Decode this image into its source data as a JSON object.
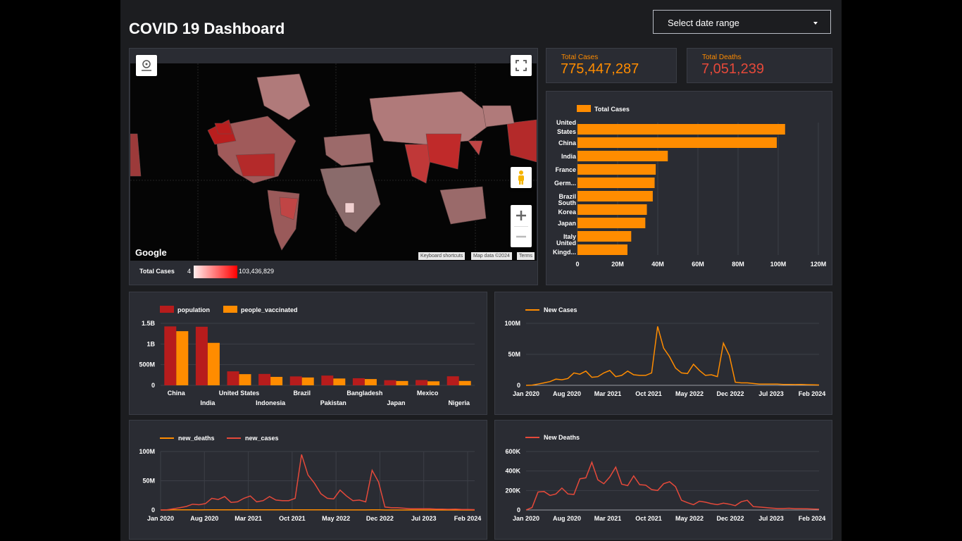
{
  "title": "COVID 19 Dashboard",
  "date_range": {
    "label": "Select date range"
  },
  "kpis": {
    "total_cases": {
      "label": "Total Cases",
      "value": "775,447,287",
      "color": "#ff8c00"
    },
    "total_deaths": {
      "label": "Total Deaths",
      "value": "7,051,239",
      "color": "#e5493a"
    }
  },
  "map": {
    "legend_label": "Total Cases",
    "legend_min": "4",
    "legend_max": "103,436,829",
    "google": "Google",
    "attribution": [
      "Keyboard shortcuts",
      "Map data ©2024",
      "Terms"
    ],
    "icons": [
      "geolocate-icon",
      "fullscreen-icon",
      "pegman-icon",
      "zoom-in-icon",
      "zoom-out-icon"
    ]
  },
  "chart_data": [
    {
      "type": "bar",
      "orientation": "horizontal",
      "legend": [
        "Total Cases"
      ],
      "categories": [
        "United States",
        "China",
        "India",
        "France",
        "Germany",
        "Brazil",
        "South Korea",
        "Japan",
        "Italy",
        "United Kingdom"
      ],
      "tick_text": [
        [
          "United",
          "States"
        ],
        [
          "China"
        ],
        [
          "India"
        ],
        [
          "France"
        ],
        [
          "Germ..."
        ],
        [
          "Brazil"
        ],
        [
          "South",
          "Korea"
        ],
        [
          "Japan"
        ],
        [
          "Italy"
        ],
        [
          "United",
          "Kingd..."
        ]
      ],
      "values": [
        103436829,
        99300000,
        45000000,
        38990000,
        38440000,
        37510000,
        34570000,
        33800000,
        26780000,
        24900000
      ],
      "xlim": [
        0,
        120000000
      ],
      "xticks": [
        "0",
        "20M",
        "40M",
        "60M",
        "80M",
        "100M",
        "120M"
      ],
      "color": "#ff8c00",
      "grid": true
    },
    {
      "type": "bar",
      "series": [
        {
          "name": "population",
          "color": "#b71c1c",
          "values": [
            1425900000,
            1417200000,
            338300000,
            275500000,
            215300000,
            235800000,
            171200000,
            123900000,
            127500000,
            218500000
          ]
        },
        {
          "name": "people_vaccinated",
          "color": "#ff8c00",
          "values": [
            1310300000,
            1027400000,
            270200000,
            204400000,
            189600000,
            165000000,
            151500000,
            104700000,
            97200000,
            105600000
          ]
        }
      ],
      "categories": [
        "China",
        "India",
        "United States",
        "Indonesia",
        "Brazil",
        "Pakistan",
        "Bangladesh",
        "Japan",
        "Mexico",
        "Nigeria"
      ],
      "ylim": [
        0,
        1500000000
      ],
      "yticks": [
        "0",
        "500M",
        "1B",
        "1.5B"
      ],
      "legend_position": "top-left"
    },
    {
      "type": "line",
      "series": [
        {
          "name": "New Cases",
          "color": "#ff8c00",
          "values": [
            0.01,
            0.3,
            2,
            4,
            6,
            10,
            9,
            11,
            20,
            18,
            23,
            13,
            14,
            20,
            24,
            14,
            16,
            23,
            17,
            16,
            16,
            20,
            95,
            60,
            46,
            28,
            20,
            19,
            34,
            24,
            16,
            17,
            14,
            68,
            48,
            5,
            4,
            4,
            3,
            2,
            2,
            2,
            2,
            1.5,
            1.5,
            1.2,
            1.4,
            1,
            0.8,
            0.6
          ]
        }
      ],
      "unit": "M",
      "ylim": [
        0,
        100
      ],
      "yticks": [
        "0",
        "50M",
        "100M"
      ],
      "xticks": [
        "Jan 2020",
        "Aug 2020",
        "Mar 2021",
        "Oct 2021",
        "May 2022",
        "Dec 2022",
        "Jul 2023",
        "Feb 2024"
      ],
      "legend_position": "top-left"
    },
    {
      "type": "line",
      "series": [
        {
          "name": "new_deaths",
          "color": "#ff8c00",
          "values": [
            0.002,
            0.05,
            0.2,
            0.3,
            0.2,
            0.2,
            0.15,
            0.2,
            0.3,
            0.3,
            0.4,
            0.4,
            0.5,
            0.4,
            0.35,
            0.3,
            0.3,
            0.35,
            0.3,
            0.3,
            0.3,
            0.3,
            0.3,
            0.4,
            0.3,
            0.2,
            0.2,
            0.15,
            0.15,
            0.1,
            0.1,
            0.1,
            0.1,
            0.2,
            0.2,
            0.05,
            0.05,
            0.05,
            0.05,
            0.03,
            0.02,
            0.02,
            0.02,
            0.02,
            0.02,
            0.02,
            0.02,
            0.01,
            0.01,
            0.01
          ]
        },
        {
          "name": "new_cases",
          "color": "#e5493a",
          "values": [
            0.01,
            0.3,
            2,
            4,
            6,
            10,
            9,
            11,
            20,
            18,
            23,
            13,
            14,
            20,
            24,
            14,
            16,
            23,
            17,
            16,
            16,
            20,
            95,
            60,
            46,
            28,
            20,
            19,
            34,
            24,
            16,
            17,
            14,
            68,
            48,
            5,
            4,
            4,
            3,
            2,
            2,
            2,
            2,
            1.5,
            1.5,
            1.2,
            1.4,
            1,
            0.8,
            0.6
          ]
        }
      ],
      "unit": "M",
      "ylim": [
        0,
        100
      ],
      "yticks": [
        "0",
        "50M",
        "100M"
      ],
      "xticks": [
        "Jan 2020",
        "Aug 2020",
        "Mar 2021",
        "Oct 2021",
        "May 2022",
        "Dec 2022",
        "Jul 2023",
        "Feb 2024"
      ],
      "legend_position": "top-left"
    },
    {
      "type": "line",
      "series": [
        {
          "name": "New Deaths",
          "color": "#e5493a",
          "values": [
            0.5,
            25,
            185,
            190,
            150,
            165,
            225,
            165,
            160,
            320,
            330,
            490,
            310,
            270,
            340,
            440,
            265,
            250,
            350,
            260,
            255,
            210,
            200,
            270,
            290,
            240,
            100,
            75,
            55,
            90,
            80,
            65,
            55,
            70,
            60,
            45,
            85,
            100,
            35,
            30,
            25,
            20,
            15,
            15,
            18,
            14,
            14,
            12,
            10,
            8
          ]
        }
      ],
      "unit": "K",
      "ylim": [
        0,
        600
      ],
      "yticks": [
        "0",
        "200K",
        "400K",
        "600K"
      ],
      "xticks": [
        "Jan 2020",
        "Aug 2020",
        "Mar 2021",
        "Oct 2021",
        "May 2022",
        "Dec 2022",
        "Jul 2023",
        "Feb 2024"
      ],
      "legend_position": "top-left"
    }
  ]
}
